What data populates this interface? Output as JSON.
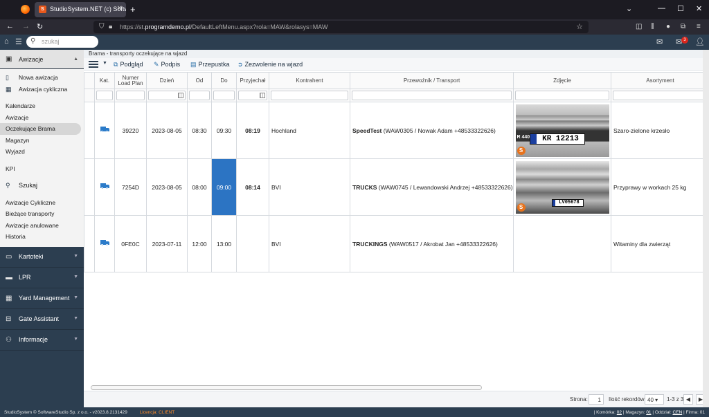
{
  "browser": {
    "tab_title": "StudioSystem.NET (c) Software",
    "url_prefix": "https://st.",
    "url_domain": "programdemo.pl",
    "url_path": "/DefaultLeftMenu.aspx?rola=MAW&rolasys=MAW"
  },
  "apptop": {
    "search_placeholder": "szukaj",
    "mail_count": "3"
  },
  "sidebar": {
    "awizacje_header": "Awizacje",
    "panel_top": [
      {
        "label": "Nowa awizacja",
        "icon": "file-icon"
      },
      {
        "label": "Awizacja cykliczna",
        "icon": "calendar-icon"
      }
    ],
    "panel_mid": [
      "Kalendarze",
      "Awizacje",
      "Oczekujące Brama",
      "Magazyn",
      "Wyjazd"
    ],
    "kpi": "KPI",
    "szukaj": "Szukaj",
    "panel_bottom": [
      "Awizacje Cykliczne",
      "Bieżące transporty",
      "Awizacje anulowane",
      "Historia"
    ],
    "sections": [
      "Kartoteki",
      "LPR",
      "Yard Management",
      "Gate Assistant",
      "Informacje"
    ]
  },
  "main": {
    "breadcrumb": "Brama - transporty oczekujące na wjazd",
    "toolbar": {
      "podglad": "Podgląd",
      "podpis": "Podpis",
      "przepustka": "Przepustka",
      "zezwolenie": "Zezwolenie na wjazd"
    },
    "columns": {
      "kat": "Kat.",
      "numer_1": "Numer",
      "numer_2": "Load Plan",
      "dzien": "Dzień",
      "od": "Od",
      "do": "Do",
      "przyjechal": "Przyjechał",
      "kontrahent": "Kontrahent",
      "przewoznik": "Przewoźnik / Transport",
      "zdjecie": "Zdjęcie",
      "asortyment": "Asortyment"
    },
    "rows": [
      {
        "numer": "39220",
        "dzien": "2023-08-05",
        "od": "08:30",
        "do": "09:30",
        "przyjechal": "08:19",
        "kontrahent": "Hochland",
        "przewoznik_bold": "SpeedTest",
        "przewoznik_rest": " (WAW0305 / Nowak Adam +48533322626)",
        "plate": "KR 12213",
        "asortyment": "Szaro-zielone krzesło"
      },
      {
        "numer": "7254D",
        "dzien": "2023-08-05",
        "od": "08:00",
        "do": "09:00",
        "przyjechal": "08:14",
        "kontrahent": "BVI",
        "przewoznik_bold": "TRUCKS",
        "przewoznik_rest": " (WAW0745 / Lewandowski Andrzej +48533322626)",
        "plate": "LV05678",
        "asortyment": "Przyprawy w workach 25 kg"
      },
      {
        "numer": "0FE0C",
        "dzien": "2023-07-11",
        "od": "12:00",
        "do": "13:00",
        "przyjechal": "",
        "kontrahent": "BVI",
        "przewoznik_bold": "TRUCKINGS",
        "przewoznik_rest": " (WAW0517 / Akrobat Jan +48533322626)",
        "plate": "",
        "asortyment": "Witaminy dla zwierząt"
      }
    ],
    "photo1_brand": "R 440",
    "pager": {
      "strona_label": "Strona:",
      "strona_value": "1",
      "rekordow_label": "Ilość rekordów:",
      "rekordow_value": "40",
      "range": "1-3 z 3"
    }
  },
  "status": {
    "copyright": "StudioSystem © SoftwareStudio Sp. z o.o. - v2023.8.2131429",
    "licencja": "Licencja: CLIENT",
    "right_prefix": "| Komórka: ",
    "komorka": "02",
    "magazyn_label": " | Magazyn: ",
    "magazyn": "01",
    "oddzial_label": " | Oddział: ",
    "oddzial": "CEN",
    "firma_label": " | Firma: 01"
  }
}
